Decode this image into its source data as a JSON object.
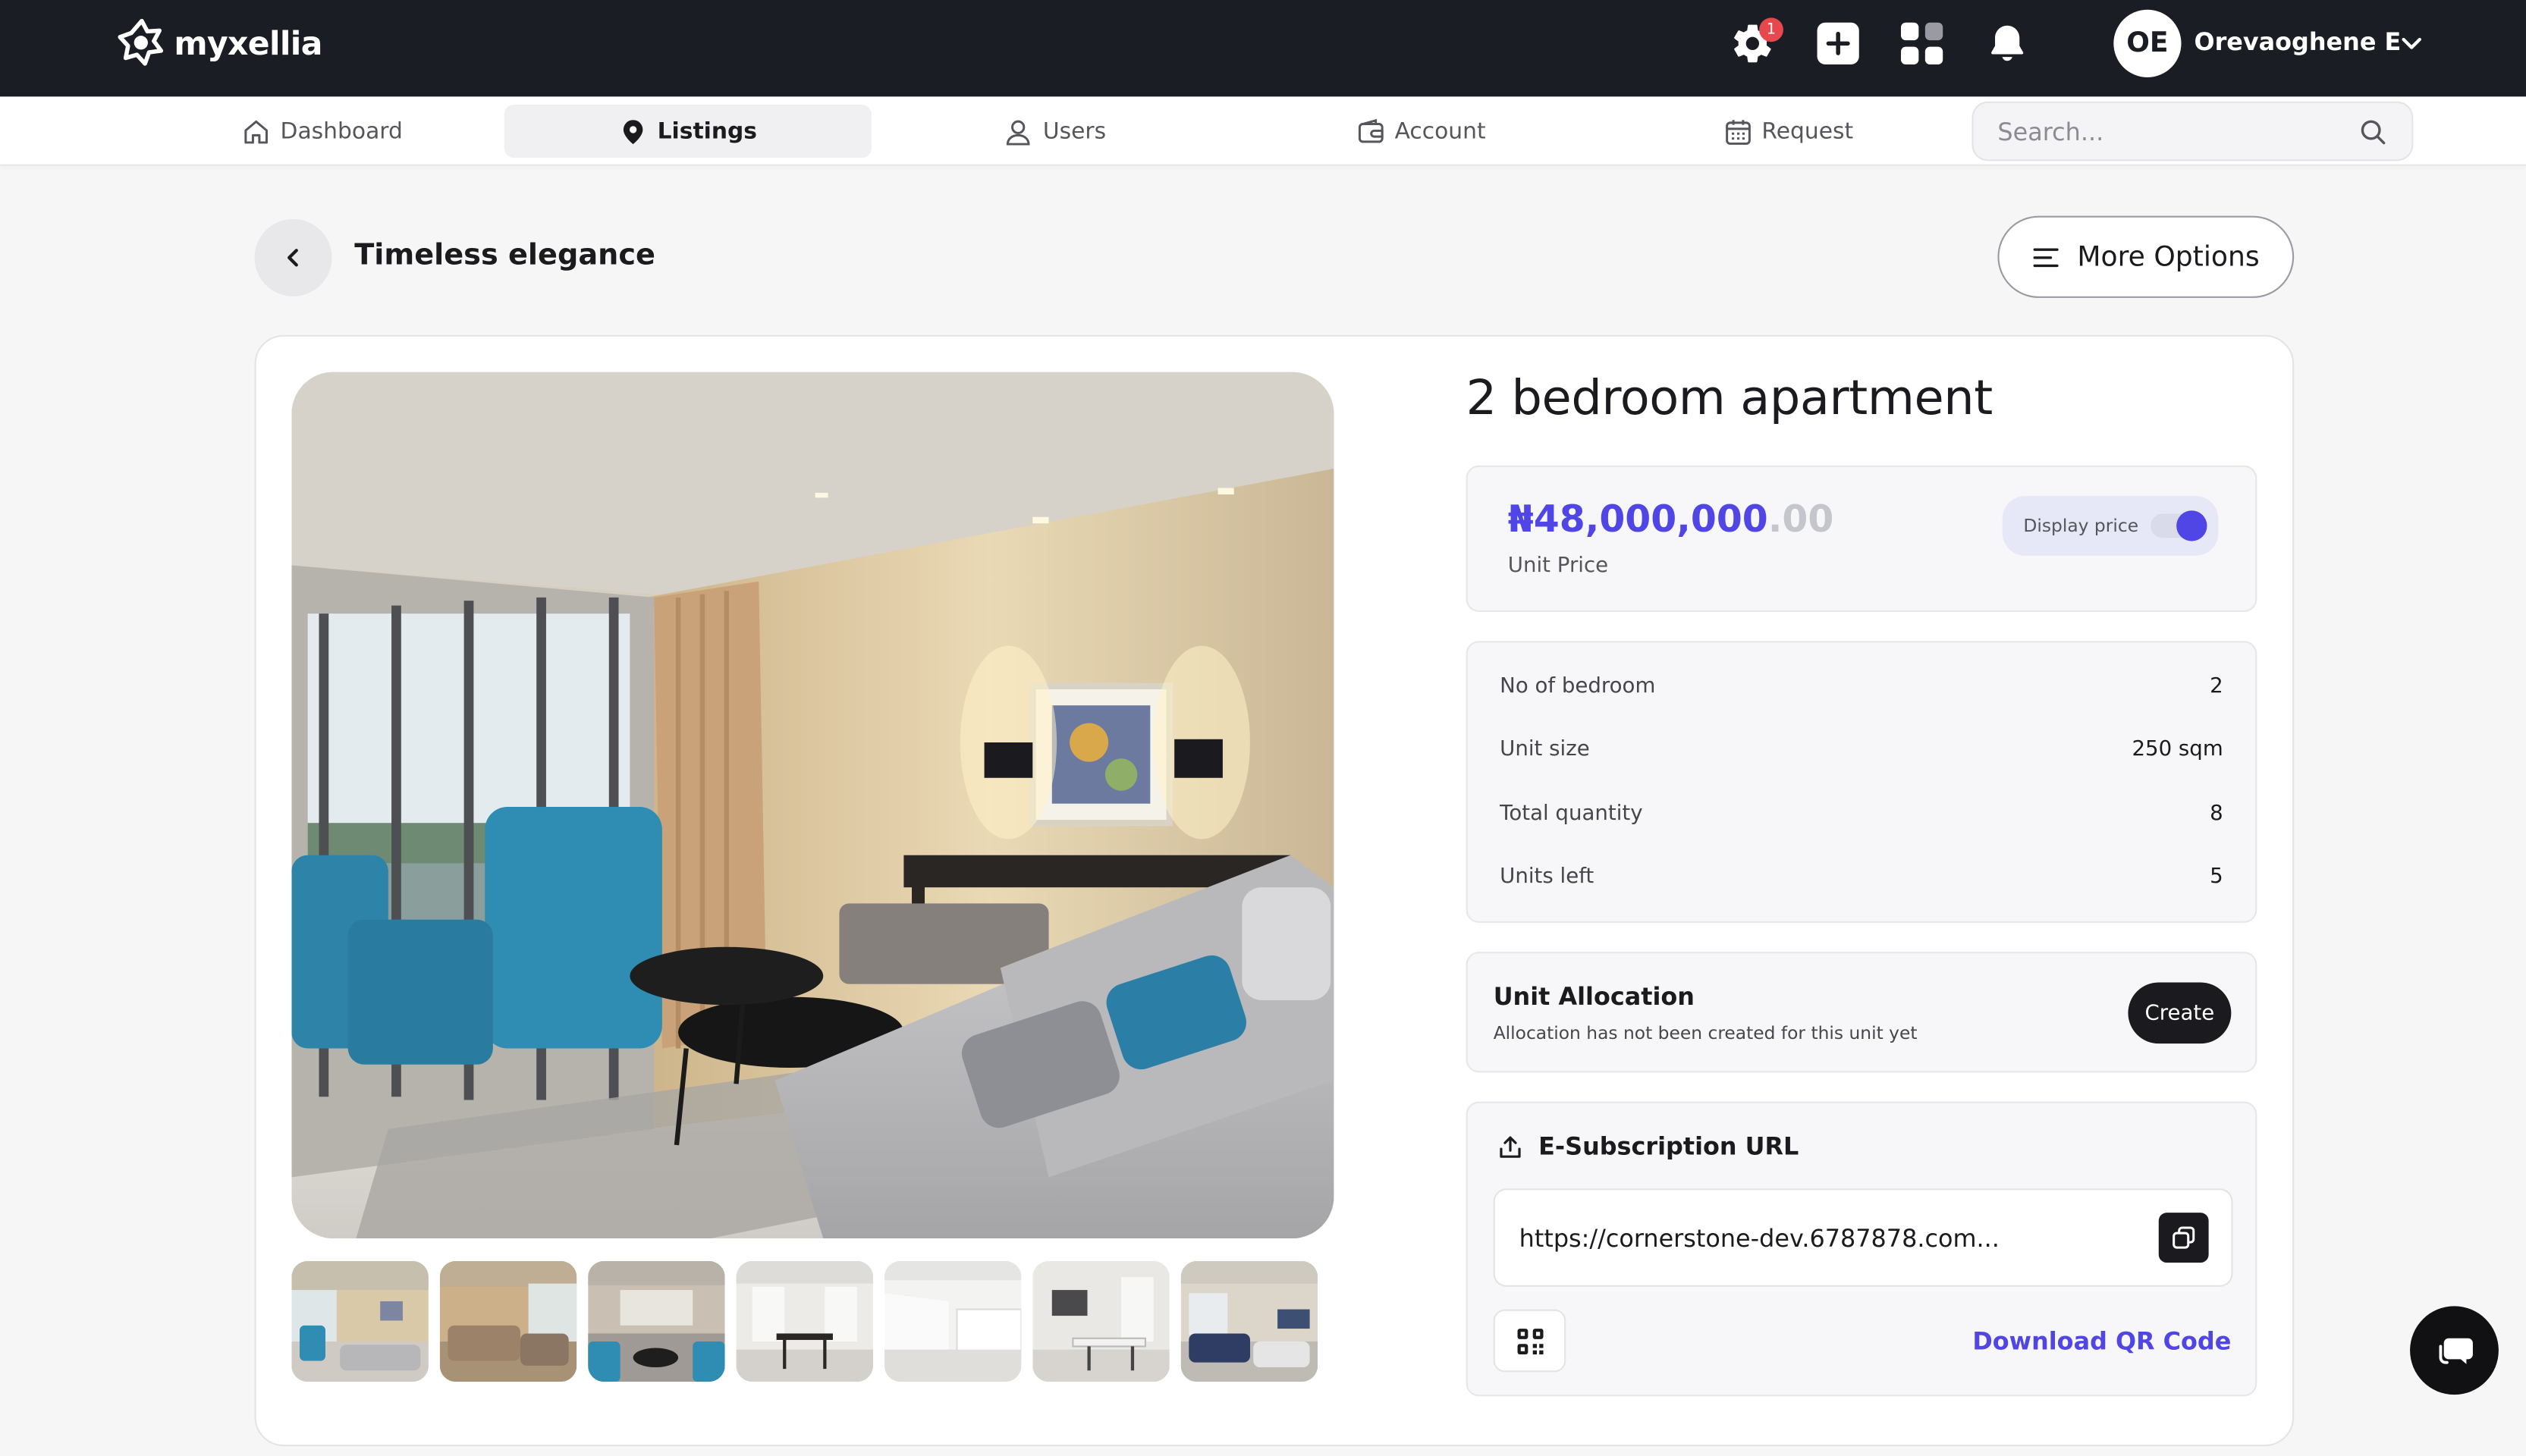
{
  "brand": {
    "name": "myxellia"
  },
  "topbar": {
    "notification_count": "1",
    "user_initials": "OE",
    "user_name": "Orevaoghene E",
    "icons": [
      "gear-icon",
      "plus-square-icon",
      "apps-grid-icon",
      "bell-icon",
      "chevron-down-icon"
    ]
  },
  "nav": {
    "items": [
      {
        "label": "Dashboard",
        "icon": "home-icon"
      },
      {
        "label": "Listings",
        "icon": "location-pin-icon",
        "active": true
      },
      {
        "label": "Users",
        "icon": "user-icon"
      },
      {
        "label": "Account",
        "icon": "wallet-icon"
      },
      {
        "label": "Request",
        "icon": "calendar-icon"
      }
    ],
    "search_placeholder": "Search..."
  },
  "header": {
    "title": "Timeless elegance",
    "more_options_label": "More Options"
  },
  "listing": {
    "title": "2 bedroom apartment",
    "price_main": "₦48,000,000",
    "price_decimals": ".00",
    "price_label": "Unit Price",
    "display_price_label": "Display price",
    "display_price_on": true,
    "details": [
      {
        "label": "No of bedroom",
        "value": "2"
      },
      {
        "label": "Unit size",
        "value": "250 sqm"
      },
      {
        "label": "Total quantity",
        "value": "8"
      },
      {
        "label": "Units left",
        "value": "5"
      }
    ],
    "allocation": {
      "title": "Unit Allocation",
      "subtitle": "Allocation has not been created for this unit yet",
      "button": "Create"
    },
    "esubscription": {
      "title": "E-Subscription URL",
      "url": "https://cornerstone-dev.6787878.com...",
      "download_label": "Download QR Code"
    },
    "thumbnail_count": 7
  },
  "colors": {
    "topbar": "#1b1d24",
    "accent": "#4f46e5",
    "badge": "#e5484d",
    "dark_button": "#1b1b1f"
  }
}
